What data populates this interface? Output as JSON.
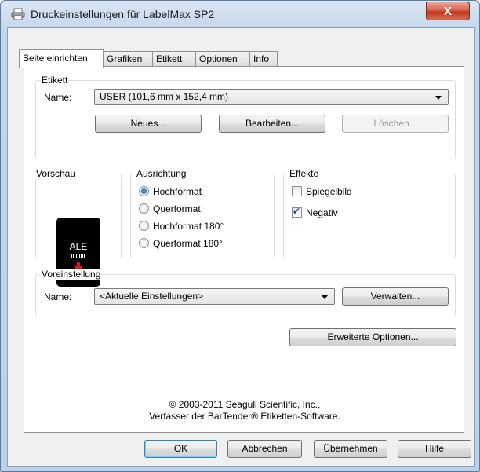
{
  "window": {
    "title": "Druckeinstellungen für LabelMax SP2",
    "close_label": "X"
  },
  "tabs": [
    {
      "label": "Seite einrichten",
      "active": true
    },
    {
      "label": "Grafiken"
    },
    {
      "label": "Etikett"
    },
    {
      "label": "Optionen"
    },
    {
      "label": "Info"
    }
  ],
  "etikett": {
    "legend": "Etikett",
    "name_label": "Name:",
    "name_value": "USER (101,6 mm x 152,4 mm)",
    "btn_new": "Neues...",
    "btn_edit": "Bearbeiten...",
    "btn_delete": "Löschen..."
  },
  "vorschau": {
    "legend": "Vorschau",
    "sample_text": "ALE"
  },
  "ausrichtung": {
    "legend": "Ausrichtung",
    "options": [
      "Hochformat",
      "Querformat",
      "Hochformat 180°",
      "Querformat 180°"
    ],
    "selected": 0
  },
  "effekte": {
    "legend": "Effekte",
    "mirror_label": "Spiegelbild",
    "mirror_checked": false,
    "negative_label": "Negativ",
    "negative_checked": true
  },
  "voreinstellung": {
    "legend": "Voreinstellung",
    "name_label": "Name:",
    "name_value": "<Aktuelle Einstellungen>",
    "btn_manage": "Verwalten..."
  },
  "advanced_button": "Erweiterte Optionen...",
  "copyright": {
    "line1": "© 2003-2011 Seagull Scientific, Inc.,",
    "line2": "Verfasser der BarTender® Etiketten-Software."
  },
  "footer": {
    "ok": "OK",
    "cancel": "Abbrechen",
    "apply": "Übernehmen",
    "help": "Hilfe"
  },
  "colors": {
    "accent_red": "#d61a1a",
    "selection_blue": "#1b5aa0"
  }
}
